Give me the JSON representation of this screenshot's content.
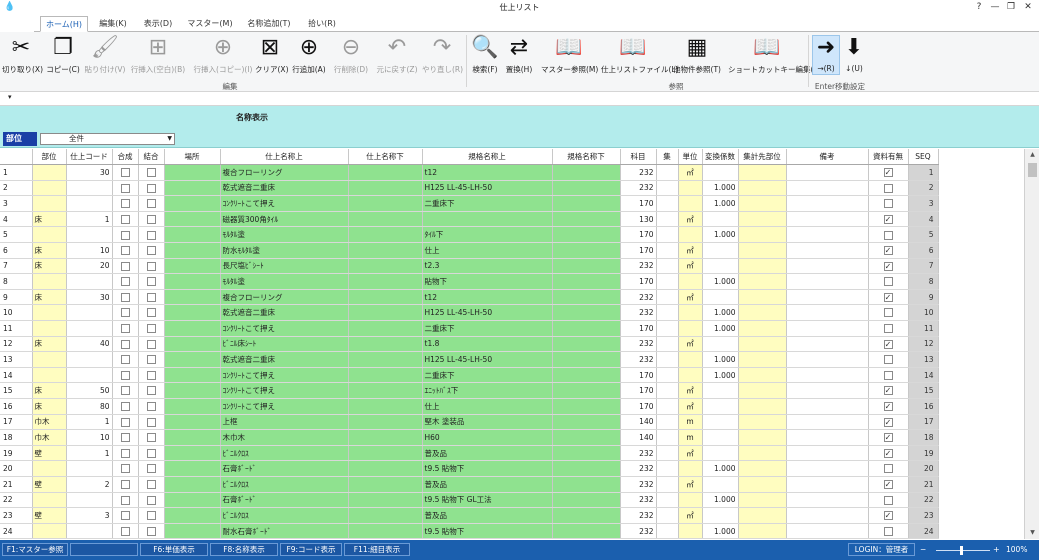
{
  "window": {
    "title": "仕上リスト"
  },
  "tabs": [
    "ホーム(H)",
    "編集(K)",
    "表示(D)",
    "マスター(M)",
    "名称追加(T)",
    "拾い(R)"
  ],
  "ribbon": {
    "buttons": [
      {
        "label": "切り取り(X)",
        "icon": "scissors-icon",
        "enabled": true
      },
      {
        "label": "コピー(C)",
        "icon": "copy-icon",
        "enabled": true
      },
      {
        "label": "貼り付け(V)",
        "icon": "paste-icon",
        "enabled": false
      },
      {
        "label": "行挿入(空白)(B)",
        "icon": "insert-row-blank-icon",
        "enabled": false
      },
      {
        "label": "行挿入(コピー)(I)",
        "icon": "insert-row-copy-icon",
        "enabled": false
      },
      {
        "label": "クリア(X)",
        "icon": "clear-icon",
        "enabled": true
      },
      {
        "label": "行追加(A)",
        "icon": "add-row-icon",
        "enabled": true
      },
      {
        "label": "行削除(D)",
        "icon": "delete-row-icon",
        "enabled": false
      },
      {
        "label": "元に戻す(Z)",
        "icon": "undo-icon",
        "enabled": false
      },
      {
        "label": "やり直し(R)",
        "icon": "redo-icon",
        "enabled": false
      },
      {
        "label": "検索(F)",
        "icon": "search-icon",
        "enabled": true
      },
      {
        "label": "置換(H)",
        "icon": "replace-icon",
        "enabled": true
      },
      {
        "label": "マスター参照(M)",
        "icon": "book-icon",
        "enabled": true
      },
      {
        "label": "仕上リストファイル(L)",
        "icon": "book-icon",
        "enabled": true
      },
      {
        "label": "他物件参照(T)",
        "icon": "grid-icon",
        "enabled": true
      },
      {
        "label": "ショートカットキー編集(S)",
        "icon": "book-icon",
        "enabled": true
      },
      {
        "label": "→(R)",
        "icon": "arrow-right-icon",
        "enabled": true
      },
      {
        "label": "↓(U)",
        "icon": "arrow-down-icon",
        "enabled": true
      }
    ],
    "groups": [
      "編集",
      "参照",
      "Enter移動設定"
    ]
  },
  "panel": {
    "display_name_label": "名称表示",
    "department_label": "部位",
    "department_value": "全件"
  },
  "columns": [
    "部位",
    "仕上コード",
    "合成",
    "結合",
    "場所",
    "仕上名称上",
    "仕上名称下",
    "規格名称上",
    "規格名称下",
    "科目",
    "集",
    "単位",
    "変換係数",
    "集計先部位",
    "備考",
    "資料有無",
    "SEQ"
  ],
  "rows": [
    {
      "n": "1",
      "bui": "",
      "code": "30",
      "name": "複合フローリング",
      "spec": "t12",
      "km": "232",
      "unit": "㎡",
      "factor": "",
      "chk": true,
      "seq": "1",
      "grp": true
    },
    {
      "n": "2",
      "bui": "",
      "code": "",
      "name": "乾式遮音二重床",
      "spec": "H125 LL-45-LH-50",
      "km": "232",
      "unit": "",
      "factor": "1.000",
      "chk": false,
      "seq": "2",
      "grp": false
    },
    {
      "n": "3",
      "bui": "",
      "code": "",
      "name": "ｺﾝｸﾘｰﾄこて押え",
      "spec": "二重床下",
      "km": "170",
      "unit": "",
      "factor": "1.000",
      "chk": false,
      "seq": "3",
      "grp": false
    },
    {
      "n": "4",
      "bui": "床",
      "code": "1",
      "name": "磁器質300角ﾀｲﾙ",
      "spec": "",
      "km": "130",
      "unit": "㎡",
      "factor": "",
      "chk": true,
      "seq": "4",
      "grp": true
    },
    {
      "n": "5",
      "bui": "",
      "code": "",
      "name": "ﾓﾙﾀﾙ塗",
      "spec": "ﾀｲﾙ下",
      "km": "170",
      "unit": "",
      "factor": "1.000",
      "chk": false,
      "seq": "5",
      "grp": false
    },
    {
      "n": "6",
      "bui": "床",
      "code": "10",
      "name": "防水ﾓﾙﾀﾙ塗",
      "spec": "仕上",
      "km": "170",
      "unit": "㎡",
      "factor": "",
      "chk": true,
      "seq": "6",
      "grp": true
    },
    {
      "n": "7",
      "bui": "床",
      "code": "20",
      "name": "長尺塩ﾋﾞｼｰﾄ",
      "spec": "t2.3",
      "km": "232",
      "unit": "㎡",
      "factor": "",
      "chk": true,
      "seq": "7",
      "grp": true
    },
    {
      "n": "8",
      "bui": "",
      "code": "",
      "name": "ﾓﾙﾀﾙ塗",
      "spec": "貼物下",
      "km": "170",
      "unit": "",
      "factor": "1.000",
      "chk": false,
      "seq": "8",
      "grp": false
    },
    {
      "n": "9",
      "bui": "床",
      "code": "30",
      "name": "複合フローリング",
      "spec": "t12",
      "km": "232",
      "unit": "㎡",
      "factor": "",
      "chk": true,
      "seq": "9",
      "grp": true
    },
    {
      "n": "10",
      "bui": "",
      "code": "",
      "name": "乾式遮音二重床",
      "spec": "H125 LL-45-LH-50",
      "km": "232",
      "unit": "",
      "factor": "1.000",
      "chk": false,
      "seq": "10",
      "grp": false
    },
    {
      "n": "11",
      "bui": "",
      "code": "",
      "name": "ｺﾝｸﾘｰﾄこて押え",
      "spec": "二重床下",
      "km": "170",
      "unit": "",
      "factor": "1.000",
      "chk": false,
      "seq": "11",
      "grp": false
    },
    {
      "n": "12",
      "bui": "床",
      "code": "40",
      "name": "ﾋﾞﾆﾙ床ｼｰﾄ",
      "spec": "t1.8",
      "km": "232",
      "unit": "㎡",
      "factor": "",
      "chk": true,
      "seq": "12",
      "grp": true
    },
    {
      "n": "13",
      "bui": "",
      "code": "",
      "name": "乾式遮音二重床",
      "spec": "H125 LL-45-LH-50",
      "km": "232",
      "unit": "",
      "factor": "1.000",
      "chk": false,
      "seq": "13",
      "grp": false
    },
    {
      "n": "14",
      "bui": "",
      "code": "",
      "name": "ｺﾝｸﾘｰﾄこて押え",
      "spec": "二重床下",
      "km": "170",
      "unit": "",
      "factor": "1.000",
      "chk": false,
      "seq": "14",
      "grp": false
    },
    {
      "n": "15",
      "bui": "床",
      "code": "50",
      "name": "ｺﾝｸﾘｰﾄこて押え",
      "spec": "ｴﾆｯﾄﾊﾞｽ下",
      "km": "170",
      "unit": "㎡",
      "factor": "",
      "chk": true,
      "seq": "15",
      "grp": true
    },
    {
      "n": "16",
      "bui": "床",
      "code": "80",
      "name": "ｺﾝｸﾘｰﾄこて押え",
      "spec": "仕上",
      "km": "170",
      "unit": "㎡",
      "factor": "",
      "chk": true,
      "seq": "16",
      "grp": true
    },
    {
      "n": "17",
      "bui": "巾木",
      "code": "1",
      "name": "上框",
      "spec": "堅木 塗装品",
      "km": "140",
      "unit": "m",
      "factor": "",
      "chk": true,
      "seq": "17",
      "grp": true
    },
    {
      "n": "18",
      "bui": "巾木",
      "code": "10",
      "name": "木巾木",
      "spec": "H60",
      "km": "140",
      "unit": "m",
      "factor": "",
      "chk": true,
      "seq": "18",
      "grp": true
    },
    {
      "n": "19",
      "bui": "壁",
      "code": "1",
      "name": "ﾋﾞﾆﾙｸﾛｽ",
      "spec": "普及品",
      "km": "232",
      "unit": "㎡",
      "factor": "",
      "chk": true,
      "seq": "19",
      "grp": true
    },
    {
      "n": "20",
      "bui": "",
      "code": "",
      "name": "石膏ﾎﾞｰﾄﾞ",
      "spec": "t9.5 貼物下",
      "km": "232",
      "unit": "",
      "factor": "1.000",
      "chk": false,
      "seq": "20",
      "grp": false
    },
    {
      "n": "21",
      "bui": "壁",
      "code": "2",
      "name": "ﾋﾞﾆﾙｸﾛｽ",
      "spec": "普及品",
      "km": "232",
      "unit": "㎡",
      "factor": "",
      "chk": true,
      "seq": "21",
      "grp": true
    },
    {
      "n": "22",
      "bui": "",
      "code": "",
      "name": "石膏ﾎﾞｰﾄﾞ",
      "spec": "t9.5 貼物下 GL工法",
      "km": "232",
      "unit": "",
      "factor": "1.000",
      "chk": false,
      "seq": "22",
      "grp": false
    },
    {
      "n": "23",
      "bui": "壁",
      "code": "3",
      "name": "ﾋﾞﾆﾙｸﾛｽ",
      "spec": "普及品",
      "km": "232",
      "unit": "㎡",
      "factor": "",
      "chk": true,
      "seq": "23",
      "grp": true
    },
    {
      "n": "24",
      "bui": "",
      "code": "",
      "name": "耐水石膏ﾎﾞｰﾄﾞ",
      "spec": "t9.5 貼物下",
      "km": "232",
      "unit": "",
      "factor": "1.000",
      "chk": false,
      "seq": "24",
      "grp": false
    }
  ],
  "statusbar": {
    "keys": [
      "F1:マスター参照",
      "",
      "F6:単価表示",
      "F8:名称表示",
      "F9:コード表示",
      "F11:細目表示"
    ],
    "login": "LOGIN：管理者",
    "zoom": "100%"
  },
  "colors": {
    "accent": "#1b5fae",
    "green_cell": "#8fe28f",
    "yellow_cell": "#fffdc0",
    "panel": "#b3ecec"
  }
}
